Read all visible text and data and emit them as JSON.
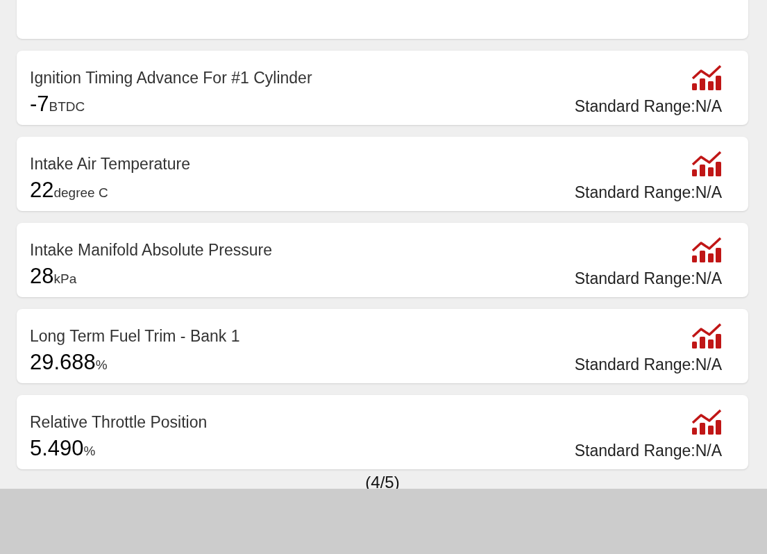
{
  "items": [
    {
      "name": "Ignition Timing Advance For #1 Cylinder",
      "value": "-7",
      "unit": "BTDC",
      "range": "Standard Range:N/A"
    },
    {
      "name": "Intake Air Temperature",
      "value": "22",
      "unit": "degree C",
      "range": "Standard Range:N/A"
    },
    {
      "name": "Intake Manifold Absolute Pressure",
      "value": "28",
      "unit": "kPa",
      "range": "Standard Range:N/A"
    },
    {
      "name": "Long Term Fuel Trim - Bank 1",
      "value": "29.688",
      "unit": "%",
      "range": "Standard Range:N/A"
    },
    {
      "name": "Relative Throttle Position",
      "value": "5.490",
      "unit": "%",
      "range": "Standard Range:N/A"
    }
  ],
  "page_indicator": "(4/5)"
}
